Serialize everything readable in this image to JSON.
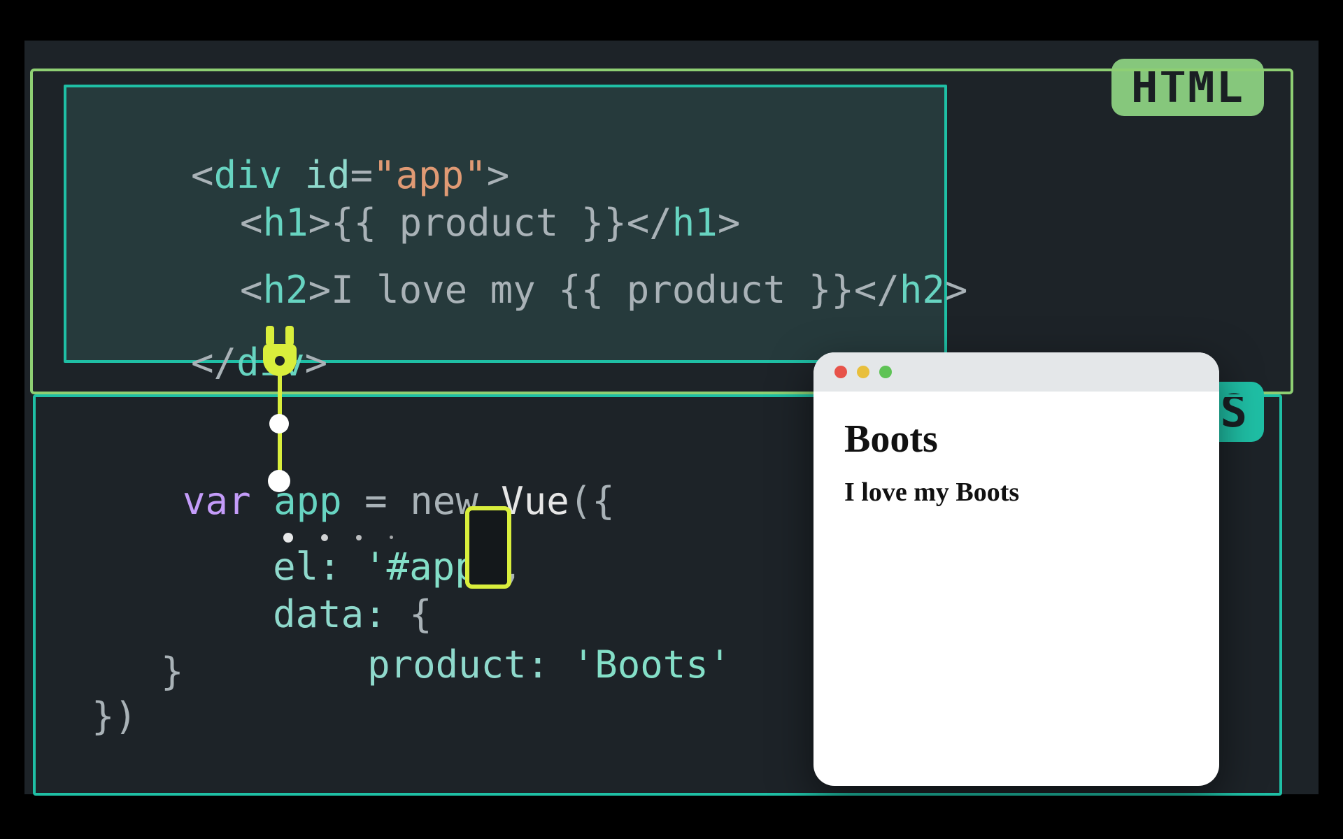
{
  "labels": {
    "html": "HTML",
    "js": "S"
  },
  "html_code": {
    "l1_open": "<div ",
    "l1_id": "id",
    "l1_eq": "=",
    "l1_val": "\"app\"",
    "l1_close": ">",
    "l2_open": "<h1>",
    "l2_body": "{{ product }}",
    "l2_close": "</h1>",
    "l3_open": "<h2>",
    "l3_body": "I love my {{ product }}",
    "l3_close": "</h2>",
    "l4": "</div>"
  },
  "js_code": {
    "l1_var": "var",
    "l1_name": " app ",
    "l1_eq": "= ",
    "l1_new": "new",
    "l1_vue": " Vue",
    "l1_paren": "({",
    "l2_key": "  el:",
    "l2_val": " '#app'",
    "l2_comma": ",",
    "l3_key": "  data:",
    "l3_brace": " {",
    "l4_key": "    product:",
    "l4_val": " 'Boots'",
    "l5": "  }",
    "l6": "})"
  },
  "preview": {
    "h1": "Boots",
    "h2": "I love my Boots"
  },
  "icons": {
    "plug": "plug-icon",
    "phone": "phone-icon"
  }
}
